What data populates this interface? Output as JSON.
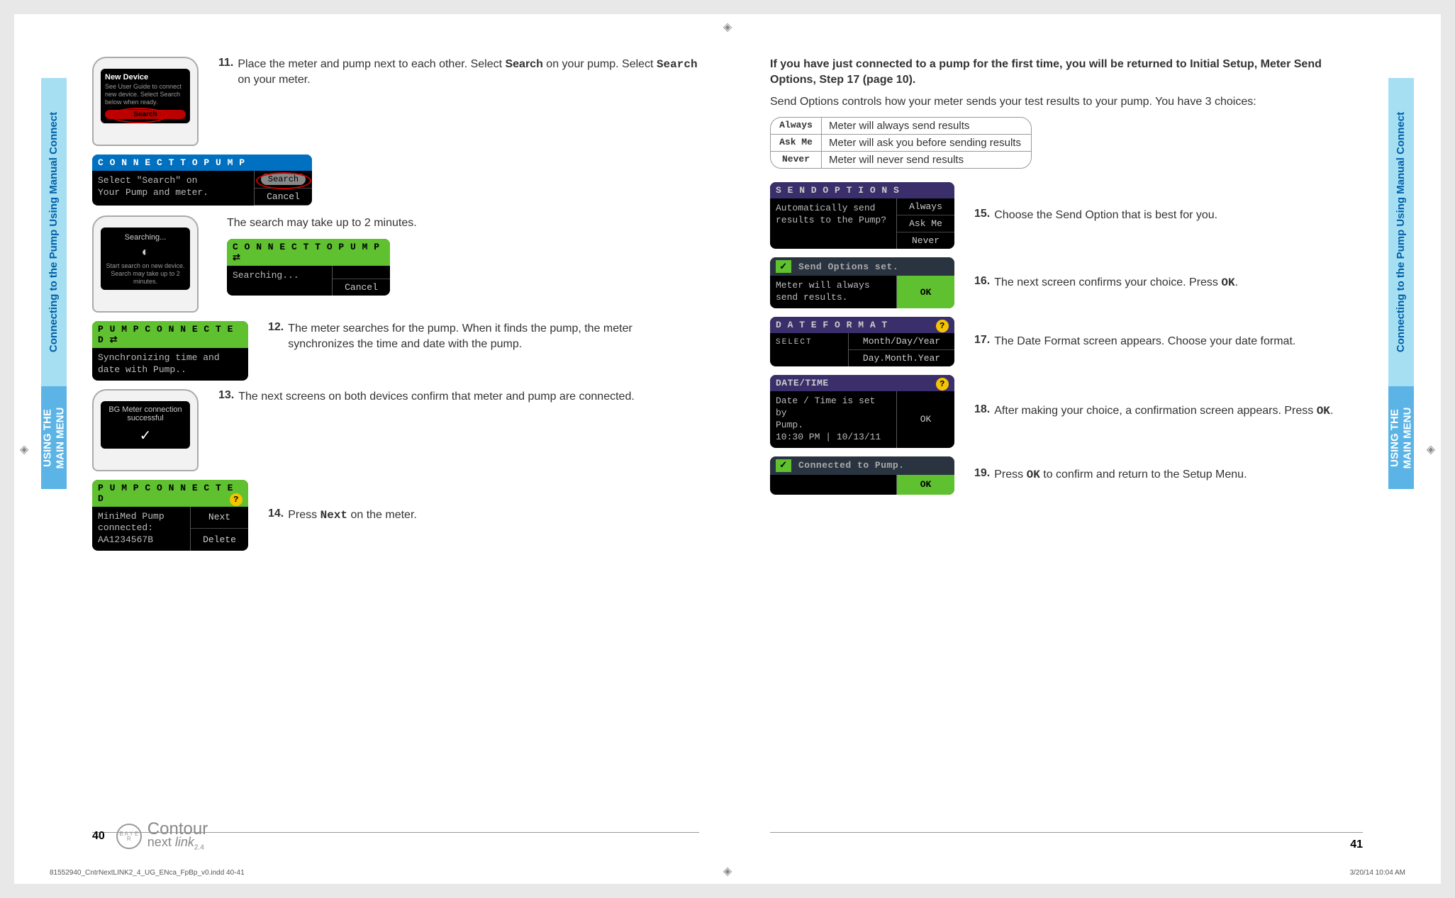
{
  "tabs": {
    "section": "Connecting to the Pump Using Manual Connect",
    "chapter_l1": "USING THE",
    "chapter_l2": "MAIN MENU"
  },
  "left": {
    "pump1": {
      "title": "New Device",
      "text": "See User Guide to connect new device. Select Search below when ready.",
      "button": "Search"
    },
    "step11": {
      "num": "11.",
      "text_a": "Place the meter and pump next to each other. Select ",
      "bold1": "Search",
      "text_b": " on your pump. Select ",
      "mono1": "Search",
      "text_c": " on your meter."
    },
    "meter1": {
      "header": "C O N N E C T  T O  P U M P",
      "line1": "Select \"Search\" on",
      "line2": "Your Pump and meter.",
      "opt1": "Search",
      "opt2": "Cancel"
    },
    "pump2": {
      "title": "Searching...",
      "text": "Start search on new device. Search may take up to 2 minutes."
    },
    "search_note": "The search may take up to 2 minutes.",
    "meter2": {
      "header": "C O N N E C T  T O  P U M P",
      "line1": "Searching...",
      "opt1": "Cancel"
    },
    "meter3": {
      "header": "P U M P  C O N N E C T E D",
      "line1": "Synchronizing time and",
      "line2": "date with Pump.."
    },
    "step12": {
      "num": "12.",
      "text": "The meter searches for the pump. When it finds the pump, the meter synchronizes the time and date with the pump."
    },
    "pump3": {
      "title": "BG Meter connection",
      "sub": "successful"
    },
    "step13": {
      "num": "13.",
      "text": "The next screens on both devices confirm that meter and pump are connected."
    },
    "meter4": {
      "header": "P U M P  C O N N E C T E D",
      "line1": "MiniMed Pump",
      "line2": "connected:",
      "line3": "AA1234567B",
      "opt1": "Next",
      "opt2": "Delete"
    },
    "step14": {
      "num": "14.",
      "text_a": "Press ",
      "mono1": "Next",
      "text_b": " on the meter."
    },
    "page_num": "40",
    "logo": {
      "brand": "B A Y E R",
      "l1": "Contour",
      "l2": "next",
      "l3": "link",
      "sub": "2.4"
    }
  },
  "right": {
    "intro_bold": "If you have just connected to a pump for the first time, you will be returned to Initial Setup, Meter Send Options, Step 17 (page 10).",
    "intro_reg": "Send Options controls how your meter sends your test results to your pump. You have 3 choices:",
    "table": [
      {
        "k": "Always",
        "v": "Meter will always send results"
      },
      {
        "k": "Ask Me",
        "v": "Meter will ask you before sending results"
      },
      {
        "k": "Never",
        "v": "Meter will never send results"
      }
    ],
    "meter5": {
      "header": "S E N D  O P T I O N S",
      "line1": "Automatically send",
      "line2": "results to the Pump?",
      "opt1": "Always",
      "opt2": "Ask Me",
      "opt3": "Never"
    },
    "step15": {
      "num": "15.",
      "text": "Choose the Send Option that is best for you."
    },
    "meter6": {
      "line1": "Send Options set.",
      "line2": "Meter will always",
      "line3": "send results.",
      "opt1": "OK"
    },
    "step16": {
      "num": "16.",
      "text_a": "The next screen confirms your choice. Press ",
      "mono1": "OK",
      "text_b": "."
    },
    "meter7": {
      "header": "D A T E  F O R M A T",
      "sel": "SELECT",
      "opt1": "Month/Day/Year",
      "opt2": "Day.Month.Year"
    },
    "step17": {
      "num": "17.",
      "text": "The Date Format screen appears. Choose your date format."
    },
    "meter8": {
      "header": "DATE/TIME",
      "line1": "Date / Time is set by",
      "line2": "Pump.",
      "line3": "10:30 PM | 10/13/11",
      "opt1": "OK"
    },
    "step18": {
      "num": "18.",
      "text_a": "After making your choice, a confirmation screen appears. Press ",
      "mono1": "OK",
      "text_b": "."
    },
    "meter9": {
      "line1": "Connected to Pump.",
      "opt1": "OK"
    },
    "step19": {
      "num": "19.",
      "text_a": "Press ",
      "mono1": "OK",
      "text_b": " to confirm and return to the Setup Menu."
    },
    "page_num": "41"
  },
  "imprint": {
    "file": "81552940_CntrNextLINK2_4_UG_ENca_FpBp_v0.indd   40-41",
    "date": "3/20/14   10:04 AM"
  }
}
